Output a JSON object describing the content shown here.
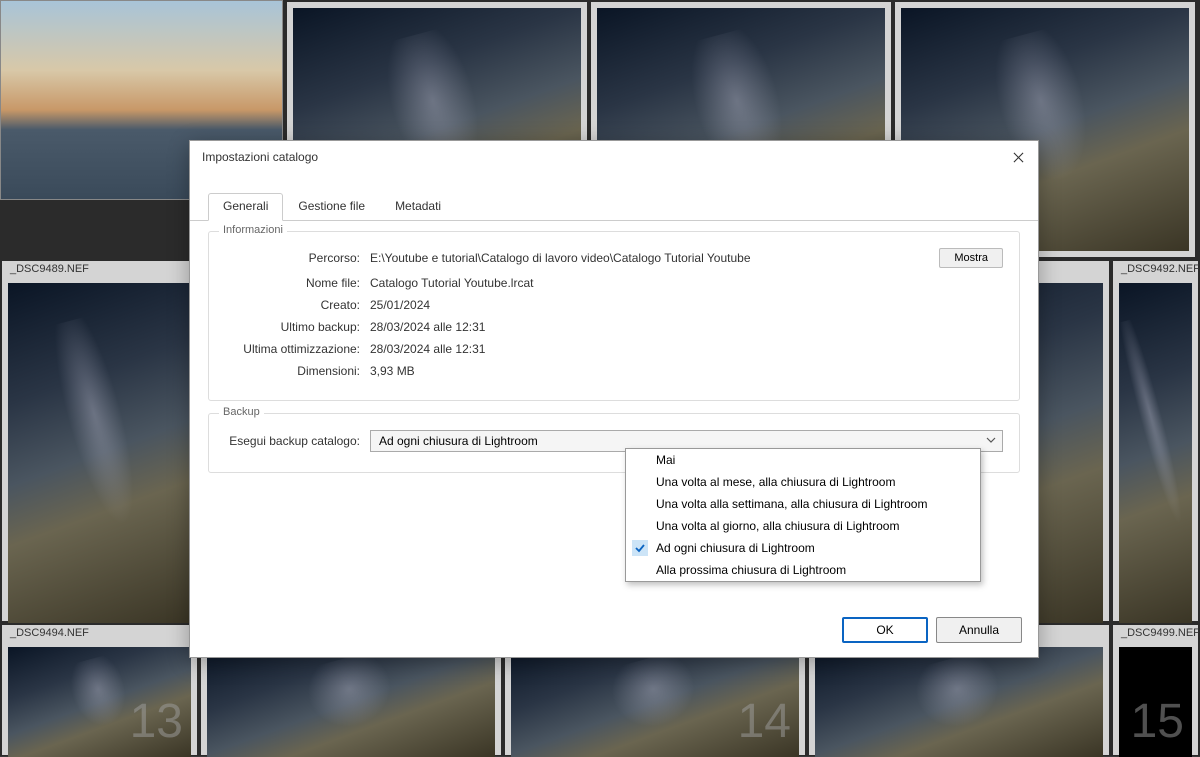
{
  "dialog": {
    "title": "Impostazioni catalogo",
    "tabs": [
      "Generali",
      "Gestione file",
      "Metadati"
    ],
    "active_tab": "Generali",
    "buttons": {
      "ok": "OK",
      "cancel": "Annulla"
    }
  },
  "info": {
    "legend": "Informazioni",
    "rows": {
      "path_label": "Percorso:",
      "path_value": "E:\\Youtube e tutorial\\Catalogo di lavoro video\\Catalogo Tutorial Youtube",
      "show_btn": "Mostra",
      "filename_label": "Nome file:",
      "filename_value": "Catalogo Tutorial Youtube.lrcat",
      "created_label": "Creato:",
      "created_value": "25/01/2024",
      "backup_label": "Ultimo backup:",
      "backup_value": "28/03/2024 alle 12:31",
      "optim_label": "Ultima ottimizzazione:",
      "optim_value": "28/03/2024 alle 12:31",
      "size_label": "Dimensioni:",
      "size_value": "3,93 MB"
    }
  },
  "backup": {
    "legend": "Backup",
    "label": "Esegui backup catalogo:",
    "selected": "Ad ogni chiusura di Lightroom",
    "options": [
      "Mai",
      "Una volta al mese, alla chiusura di Lightroom",
      "Una volta alla settimana, alla chiusura di Lightroom",
      "Una volta al giorno, alla chiusura di Lightroom",
      "Ad ogni chiusura di Lightroom",
      "Alla prossima chiusura di Lightroom"
    ],
    "checked_index": 4
  },
  "thumbs": {
    "labels": [
      "_DSC9489.NEF",
      "_DSC9492.NEF",
      "_DSC9494.NEF",
      "_DSC9499.NEF"
    ]
  }
}
